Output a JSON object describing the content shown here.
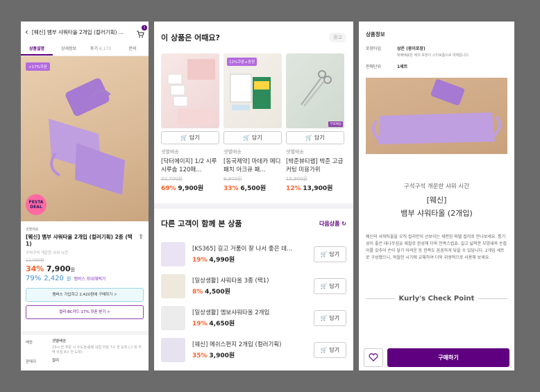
{
  "detail": {
    "title": "[웨신] 뱀부 샤워타올 2개입 (컬러기획) ...",
    "cart_count": "1",
    "tabs": [
      {
        "label": "상품설명",
        "count": ""
      },
      {
        "label": "상세정보",
        "count": ""
      },
      {
        "label": "후기",
        "count": "6,170"
      },
      {
        "label": "문의",
        "count": ""
      }
    ],
    "hero_coupon": "+17%쿠폰",
    "festa_line1": "FESTA",
    "festa_line2": "DEAL",
    "shipping_label": "샛별배송",
    "product_name": "[웨신] 뱀부 샤워타올 2개입 (컬러기획) 2종 (택1)",
    "subdesc": "구석구석 개운한 샤워 시간",
    "original_price": "12,000원",
    "discount": "34%",
    "price": "7,900",
    "won": "원",
    "member_discount": "79%",
    "member_price": "2,420",
    "member_won": "원",
    "member_note": "멤버스 최대혜택가",
    "member_button": "멤버스 가입하고 2,420원에 구매하기 >",
    "card_button": "컬리·BC카드 17% 쿠폰 받기 >",
    "delivery_key": "배송",
    "delivery_val": "샛별배송",
    "delivery_note": "23시 전 주문 시 수도권/충청 내일 아침 7시 전 도착 (그 외 지역 아침 8시 전 도착)",
    "seller_key": "판매자",
    "seller_val": "컬리"
  },
  "recommend": {
    "title": "이 상품은 어때요?",
    "ad_label": "광고",
    "add_label": "담기",
    "items": [
      {
        "ship": "샛별배송",
        "name": "[닥터에이지] 1/2 시루시루솜 120매...",
        "orig": "32,700원",
        "disc": "69%",
        "price": "9,900원",
        "badge": ""
      },
      {
        "ship": "샛별배송",
        "name": "[동국제약] 마데카 메디패치 아크큐 패...",
        "orig": "9,800원",
        "disc": "33%",
        "price": "6,500원",
        "badge": "12%쿠폰+증정"
      },
      {
        "ship": "샛별배송",
        "name": "[박준뷰티랩] 박준 고급 커팅 미용가위",
        "orig": "15,900원",
        "disc": "12%",
        "price": "13,900원",
        "badge": "무료배송"
      }
    ]
  },
  "others": {
    "title": "다른 고객이 함께 본 상품",
    "next_label": "다음상품",
    "add_label": "담기",
    "items": [
      {
        "name": "[KS365] 길고 거품이 잘 나서 좋은 데...",
        "disc": "19%",
        "price": "4,990원"
      },
      {
        "name": "[일상생활] 샤워타올 3종 (택1)",
        "disc": "8%",
        "price": "4,500원"
      },
      {
        "name": "[일상생활] 엠보샤워타올 2개입",
        "disc": "19%",
        "price": "4,650원"
      },
      {
        "name": "[웨신] 메쉬스펀지 2개입 (컬러기획)",
        "disc": "35%",
        "price": "3,900원"
      }
    ]
  },
  "info": {
    "title": "상품정보",
    "pack_key": "포장타입",
    "pack_val": "상온 (종이포장)",
    "pack_note": "택배배송은 에코 포장이 스티로폼으로 대체됩니다.",
    "unit_key": "판매단위",
    "unit_val": "1세트",
    "subtitle": "구석구석 개운한 샤워 시간",
    "name1": "[웨신]",
    "name2": "뱀부 샤워타올 (2개입)",
    "desc": "웨신의 샤워타올을 오직 컬리만이 선보이는 세련된 파텔 컬러로 만나보세요. 통기성이 좋은 대나무섬유 재질로 완성해 더욱 만족스럽죠. 길고 넓적한 모양새와 손잡이를 갖추어 손이 닿기 어려운 등 한쪽도 꼼꼼하게 닦을 수 있답니다. 2개입 세트로 구성했으니, 적절한 시기에 교체하여 더욱 위생적으로 사용해 보세요.",
    "checkpoint": "Kurly's Check Point",
    "buy_label": "구매하기"
  },
  "colors": {
    "brand": "#5f0080",
    "discount": "#fa622f",
    "member": "#3c8ecc",
    "towel": "#b792d9"
  }
}
